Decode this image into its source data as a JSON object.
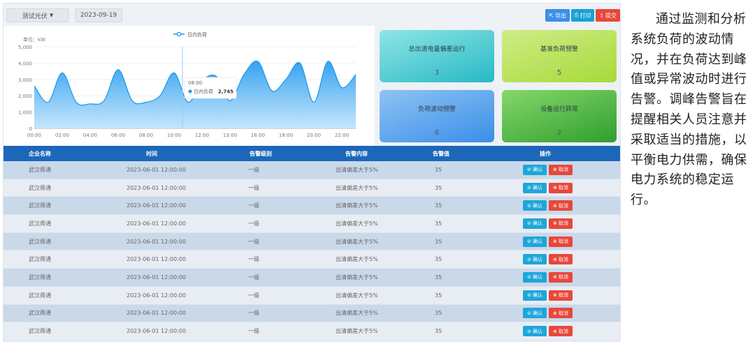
{
  "toolbar": {
    "select_value": "测试光伏",
    "date_value": "2023-09-19",
    "export_label": "导出",
    "print_label": "打印",
    "submit_label": "提交"
  },
  "colors": {
    "header_blue": "#1c67b8",
    "line_blue": "#1e9be8",
    "confirm": "#1fa6d8",
    "cancel": "#e8473b"
  },
  "chart_data": {
    "type": "area",
    "legend": "日内负荷",
    "ylabel": "单位：kW",
    "ylim": [
      0,
      5000
    ],
    "yticks": [
      "0",
      "1,000",
      "2,000",
      "3,000",
      "4,000",
      "5,000"
    ],
    "xticks": [
      "00:00",
      "02:00",
      "04:00",
      "06:00",
      "08:00",
      "10:00",
      "12:00",
      "13:00",
      "16:00",
      "18:00",
      "20:00",
      "22:00"
    ],
    "x": [
      0,
      1,
      2,
      3,
      4,
      5,
      6,
      7,
      8,
      9,
      10,
      11,
      12,
      13,
      14,
      15,
      16,
      17,
      18,
      19,
      20,
      21,
      22,
      23
    ],
    "values": [
      2600,
      1600,
      3400,
      1600,
      1500,
      1700,
      3600,
      1700,
      1600,
      2000,
      3400,
      1600,
      2900,
      3200,
      1700,
      3300,
      4100,
      2300,
      3000,
      4000,
      1600,
      4100,
      2500,
      3300
    ],
    "tooltip": {
      "time": "08:00",
      "series": "日内负荷",
      "value": "2,745"
    },
    "cursor_x": 10.6
  },
  "tiles": [
    {
      "label": "总出清电量偏差运行",
      "value": "3"
    },
    {
      "label": "基准负荷预警",
      "value": "5"
    },
    {
      "label": "负荷波动预警",
      "value": "6"
    },
    {
      "label": "设备运行异常",
      "value": "2"
    }
  ],
  "table": {
    "headers": [
      "企业名称",
      "时间",
      "告警级别",
      "告警内容",
      "告警值",
      "操作"
    ],
    "confirm_label": "确认",
    "cancel_label": "取消",
    "rows": [
      [
        "武汉舜通",
        "2023-06-01 12:00:00",
        "一级",
        "出清偏差大于5%",
        "35"
      ],
      [
        "武汉舜通",
        "2023-06-01 12:00:00",
        "一级",
        "出清偏差大于5%",
        "35"
      ],
      [
        "武汉舜通",
        "2023-06-01 12:00:00",
        "一级",
        "出清偏差大于5%",
        "35"
      ],
      [
        "武汉舜通",
        "2023-06-01 12:00:00",
        "一级",
        "出清偏差大于5%",
        "35"
      ],
      [
        "武汉舜通",
        "2023-06-01 12:00:00",
        "一级",
        "出清偏差大于5%",
        "35"
      ],
      [
        "武汉舜通",
        "2023-06-01 12:00:00",
        "一级",
        "出清偏差大于5%",
        "35"
      ],
      [
        "武汉舜通",
        "2023-06-01 12:00:00",
        "一级",
        "出清偏差大于5%",
        "35"
      ],
      [
        "武汉舜通",
        "2023-06-01 12:00:00",
        "一级",
        "出清偏差大于5%",
        "35"
      ],
      [
        "武汉舜通",
        "2023-06-01 12:00:00",
        "一级",
        "出清偏差大于5%",
        "35"
      ],
      [
        "武汉舜通",
        "2023-06-01 12:00:00",
        "一级",
        "出清偏差大于5%",
        "35"
      ]
    ]
  },
  "description": "通过监测和分析系统负荷的波动情况，并在负荷达到峰值或异常波动时进行告警。调峰告警旨在提醒相关人员注意并采取适当的措施，以平衡电力供需，确保电力系统的稳定运行。"
}
